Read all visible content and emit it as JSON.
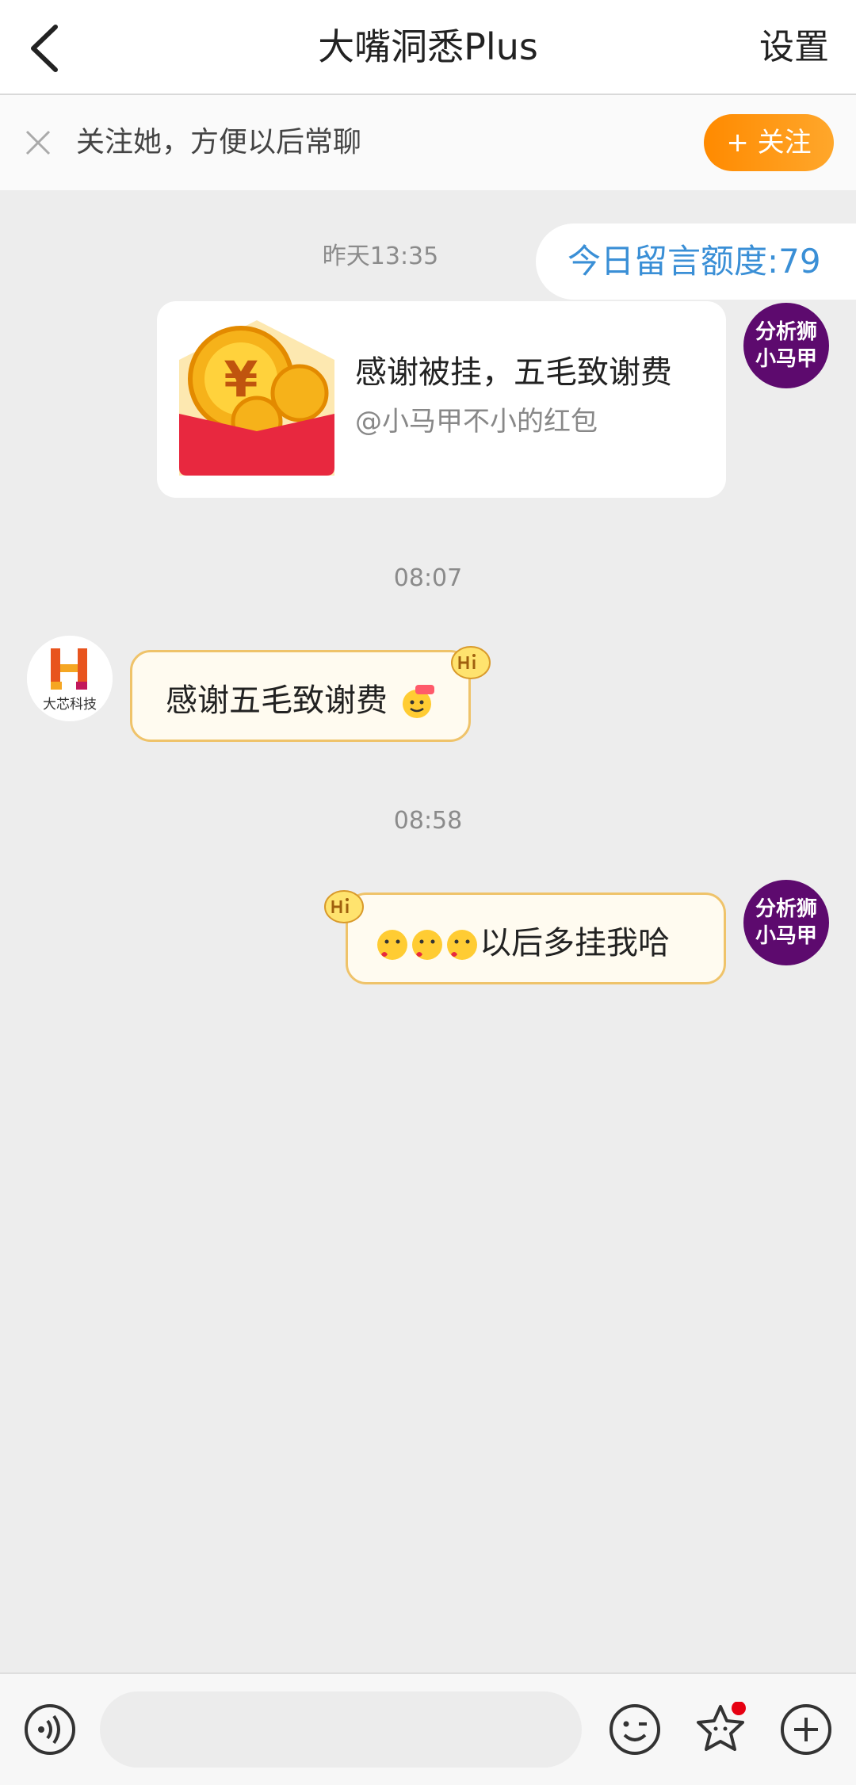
{
  "header": {
    "title": "大嘴洞悉Plus",
    "settings_label": "设置"
  },
  "follow_bar": {
    "text": "关注她，方便以后常聊",
    "button_label": "+ 关注"
  },
  "messages": {
    "time1": "昨天13:35",
    "quota_text": "今日留言额度:79",
    "red_packet": {
      "title": "感谢被挂，五毛致谢费",
      "subtitle": "@小马甲不小的红包"
    },
    "my_avatar_line1": "分析狮",
    "my_avatar_line2": "小马甲",
    "time2": "08:07",
    "incoming_text": "感谢五毛致谢费",
    "incoming_avatar_text": "大芯科技",
    "time3": "08:58",
    "outgoing_text": "以后多挂我哈"
  },
  "icons": [
    "back-arrow-icon",
    "close-icon",
    "voice-icon",
    "emoji-icon",
    "sticker-icon",
    "plus-icon",
    "red-packet-icon",
    "hi-badge-icon"
  ],
  "colors": {
    "accent_orange": "#ff8a00",
    "quota_blue": "#3a8fd6",
    "avatar_purple": "#5d0a6e",
    "bubble_border": "#efc36a",
    "notification_red": "#e60012"
  }
}
